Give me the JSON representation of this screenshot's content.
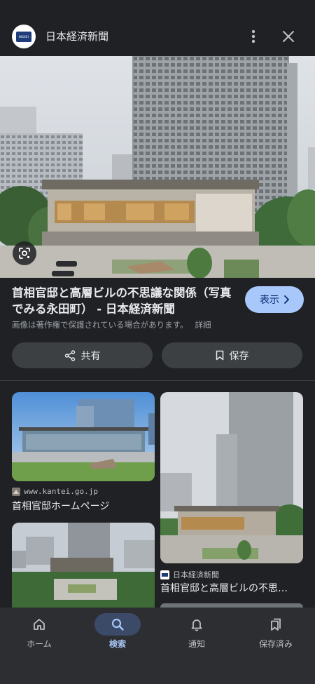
{
  "header": {
    "logo_text": "NIKKEI",
    "site_name": "日本経済新聞",
    "more_icon": "more-vert-icon",
    "close_icon": "close-icon"
  },
  "hero": {
    "lens_icon": "lens-icon"
  },
  "result": {
    "title": "首相官邸と高層ビルの不思議な関係（写真でみる永田町） - 日本経済新聞",
    "show_label": "表示",
    "copyright_notice": "画像は著作権で保護されている場合があります。",
    "details_link": "詳細"
  },
  "actions": {
    "share_label": "共有",
    "save_label": "保存"
  },
  "related": [
    {
      "source": "www.kantei.go.jp",
      "title": "首相官邸ホームページ"
    },
    {
      "source": "日本経済新聞",
      "title": "首相官邸と高層ビルの不思…"
    }
  ],
  "nav": {
    "items": [
      {
        "label": "ホーム",
        "icon": "home-icon"
      },
      {
        "label": "検索",
        "icon": "search-icon",
        "active": true
      },
      {
        "label": "通知",
        "icon": "bell-icon"
      },
      {
        "label": "保存済み",
        "icon": "bookmarks-icon"
      }
    ]
  },
  "colors": {
    "background": "#202124",
    "accent": "#a8c7fa",
    "pill": "#3c4043",
    "nav_background": "#2d2e31"
  }
}
